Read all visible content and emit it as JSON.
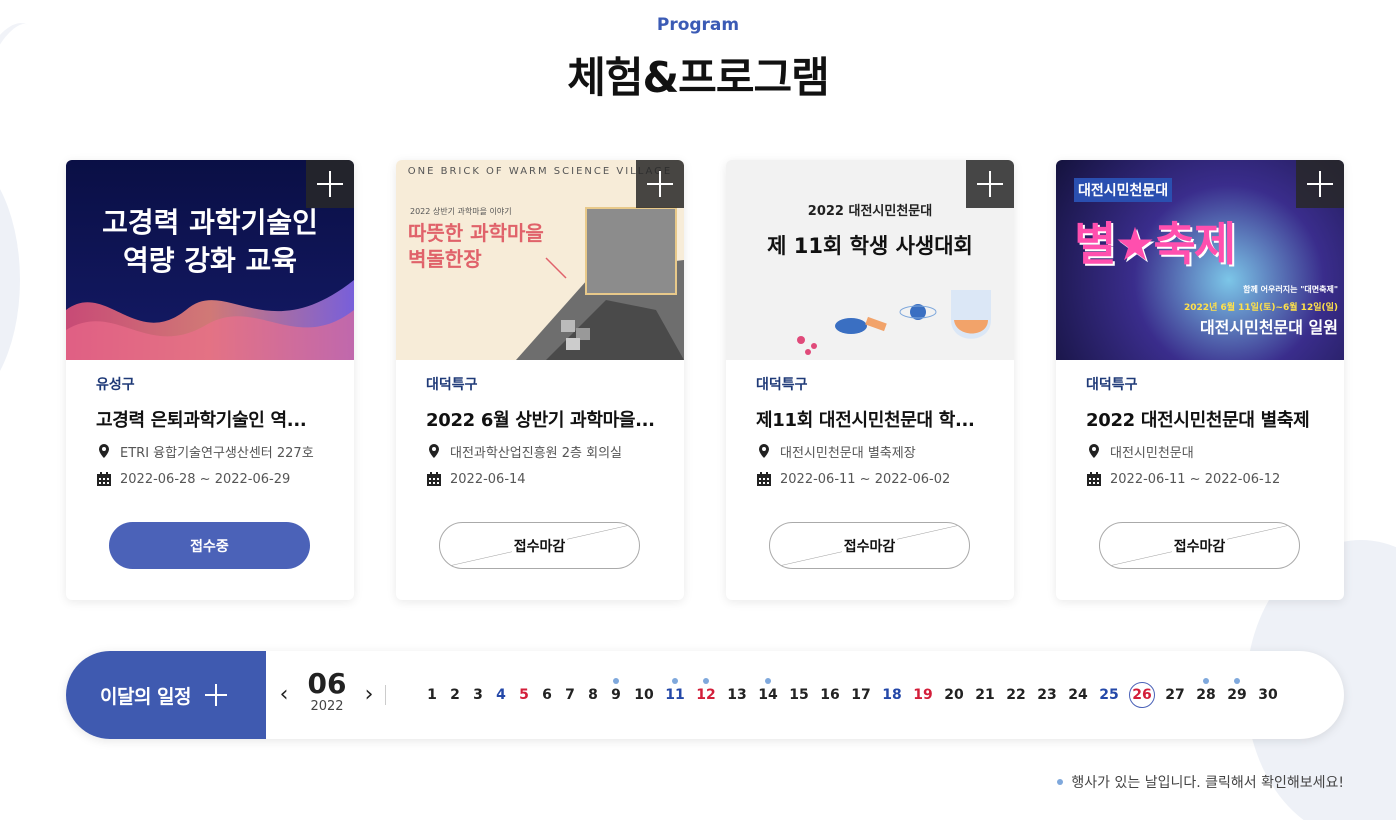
{
  "header": {
    "eyebrow": "Program",
    "title": "체험&프로그램"
  },
  "cards": [
    {
      "image_text_line1": "고경력 과학기술인",
      "image_text_line2": "역량 강화 교육",
      "region": "유성구",
      "title": "고경력 은퇴과학기술인 역...",
      "location": "ETRI 융합기술연구생산센터 227호",
      "date": "2022-06-28 ~ 2022-06-29",
      "status": "접수중"
    },
    {
      "image_text_top": "ONE BRICK OF WARM SCIENCE VILLAGE",
      "image_text_sub": "2022 상반기 과학마을 이야기",
      "image_text_line1": "따뜻한 과학마을",
      "image_text_line2": "벽돌한장",
      "region": "대덕특구",
      "title": "2022 6월 상반기 과학마을...",
      "location": "대전과학산업진흥원 2층 회의실",
      "date": "2022-06-14",
      "status": "접수마감"
    },
    {
      "image_text_sub": "2022 대전시민천문대",
      "image_text_line1": "제 11회 학생 사생대회",
      "region": "대덕특구",
      "title": "제11회 대전시민천문대 학...",
      "location": "대전시민천문대 별축제장",
      "date": "2022-06-11 ~ 2022-06-02",
      "status": "접수마감"
    },
    {
      "image_text_top": "대전시민천문대",
      "image_text_line1": "별★축제",
      "image_text_sub": "함께 어우러지는 \"대면축제\"",
      "image_text_date": "2022년 6월 11일(토)~6월 12일(일)",
      "image_text_line2": "대전시민천문대 일원",
      "region": "대덕특구",
      "title": "2022 대전시민천문대 별축제",
      "location": "대전시민천문대",
      "date": "2022-06-11 ~ 2022-06-12",
      "status": "접수마감"
    }
  ],
  "calendar": {
    "heading": "이달의 일정",
    "prev_icon": "chevron-left-icon",
    "next_icon": "chevron-right-icon",
    "month": "06",
    "year": "2022",
    "days": [
      {
        "n": "1",
        "color": "normal",
        "event": false
      },
      {
        "n": "2",
        "color": "normal",
        "event": false
      },
      {
        "n": "3",
        "color": "normal",
        "event": false
      },
      {
        "n": "4",
        "color": "blue",
        "event": false
      },
      {
        "n": "5",
        "color": "red",
        "event": false
      },
      {
        "n": "6",
        "color": "normal",
        "event": false
      },
      {
        "n": "7",
        "color": "normal",
        "event": false
      },
      {
        "n": "8",
        "color": "normal",
        "event": false
      },
      {
        "n": "9",
        "color": "normal",
        "event": true
      },
      {
        "n": "10",
        "color": "normal",
        "event": false
      },
      {
        "n": "11",
        "color": "blue",
        "event": true
      },
      {
        "n": "12",
        "color": "red",
        "event": true
      },
      {
        "n": "13",
        "color": "normal",
        "event": false
      },
      {
        "n": "14",
        "color": "normal",
        "event": true
      },
      {
        "n": "15",
        "color": "normal",
        "event": false
      },
      {
        "n": "16",
        "color": "normal",
        "event": false
      },
      {
        "n": "17",
        "color": "normal",
        "event": false
      },
      {
        "n": "18",
        "color": "blue",
        "event": false
      },
      {
        "n": "19",
        "color": "red",
        "event": false
      },
      {
        "n": "20",
        "color": "normal",
        "event": false
      },
      {
        "n": "21",
        "color": "normal",
        "event": false
      },
      {
        "n": "22",
        "color": "normal",
        "event": false
      },
      {
        "n": "23",
        "color": "normal",
        "event": false
      },
      {
        "n": "24",
        "color": "normal",
        "event": false
      },
      {
        "n": "25",
        "color": "blue",
        "event": false
      },
      {
        "n": "26",
        "color": "today",
        "event": false
      },
      {
        "n": "27",
        "color": "normal",
        "event": false
      },
      {
        "n": "28",
        "color": "normal",
        "event": true
      },
      {
        "n": "29",
        "color": "normal",
        "event": true
      },
      {
        "n": "30",
        "color": "normal",
        "event": false
      }
    ],
    "legend": "행사가 있는 날입니다. 클릭해서 확인해보세요!"
  },
  "colors": {
    "accent": "#3f5ab0",
    "region_text": "#1f3a78",
    "sunday": "#d31e3a",
    "saturday": "#2448a8",
    "event_dot": "#7fa8dc"
  }
}
